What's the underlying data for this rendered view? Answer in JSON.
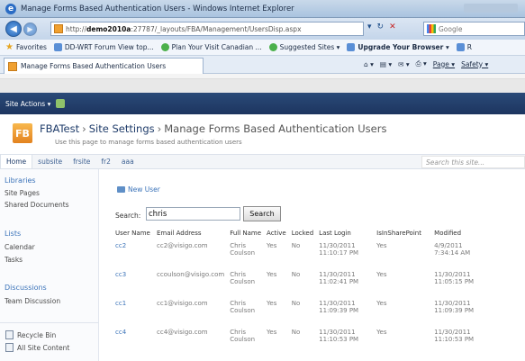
{
  "window": {
    "title": "Manage Forms Based Authentication Users - Windows Internet Explorer"
  },
  "address_bar": {
    "url_prefix": "http://",
    "url_host": "demo2010a",
    "url_path": ":27787/_layouts/FBA/Management/UsersDisp.aspx",
    "search_placeholder": "Google"
  },
  "favorites": {
    "label": "Favorites",
    "items": [
      "DD-WRT Forum View top...",
      "Plan Your Visit Canadian ...",
      "Suggested Sites ▾",
      "Upgrade Your Browser ▾",
      "R"
    ]
  },
  "tab": {
    "label": "Manage Forms Based Authentication Users"
  },
  "command_bar": {
    "page": "Page ▾",
    "safety": "Safety ▾"
  },
  "ribbon": {
    "site_actions": "Site Actions ▾"
  },
  "site": {
    "logo_text": "FB",
    "title": "FBATest",
    "sep": "›",
    "settings": "Site Settings",
    "current": "Manage Forms Based Authentication Users",
    "description": "Use this page to manage forms based authentication users"
  },
  "topnav": {
    "items": [
      "Home",
      "subsite",
      "frsite",
      "fr2",
      "aaa"
    ],
    "search_placeholder": "Search this site..."
  },
  "quicklaunch": {
    "libraries_head": "Libraries",
    "libraries": [
      "Site Pages",
      "Shared Documents"
    ],
    "lists_head": "Lists",
    "lists": [
      "Calendar",
      "Tasks"
    ],
    "discussions_head": "Discussions",
    "discussions": [
      "Team Discussion"
    ],
    "recycle_bin": "Recycle Bin",
    "all_content": "All Site Content"
  },
  "main": {
    "new_user": "New User",
    "search_label": "Search:",
    "search_value": "chris",
    "search_button": "Search",
    "columns": [
      "User Name",
      "Email Address",
      "Full Name",
      "Active",
      "Locked",
      "Last Login",
      "IsInSharePoint",
      "Modified"
    ],
    "rows": [
      {
        "user": "cc2",
        "email": "cc2@visigo.com",
        "full1": "Chris",
        "full2": "Coulson",
        "active": "Yes",
        "locked": "No",
        "login1": "11/30/2011",
        "login2": "11:10:17 PM",
        "insp": "Yes",
        "mod1": "4/9/2011",
        "mod2": "7:34:14 AM"
      },
      {
        "user": "cc3",
        "email": "ccoulson@visigo.com",
        "full1": "Chris",
        "full2": "Coulson",
        "active": "Yes",
        "locked": "No",
        "login1": "11/30/2011",
        "login2": "11:02:41 PM",
        "insp": "Yes",
        "mod1": "11/30/2011",
        "mod2": "11:05:15 PM"
      },
      {
        "user": "cc1",
        "email": "cc1@visigo.com",
        "full1": "Chris",
        "full2": "Coulson",
        "active": "Yes",
        "locked": "No",
        "login1": "11/30/2011",
        "login2": "11:09:39 PM",
        "insp": "Yes",
        "mod1": "11/30/2011",
        "mod2": "11:09:39 PM"
      },
      {
        "user": "cc4",
        "email": "cc4@visigo.com",
        "full1": "Chris",
        "full2": "Coulson",
        "active": "Yes",
        "locked": "No",
        "login1": "11/30/2011",
        "login2": "11:10:53 PM",
        "insp": "Yes",
        "mod1": "11/30/2011",
        "mod2": "11:10:53 PM"
      }
    ]
  }
}
